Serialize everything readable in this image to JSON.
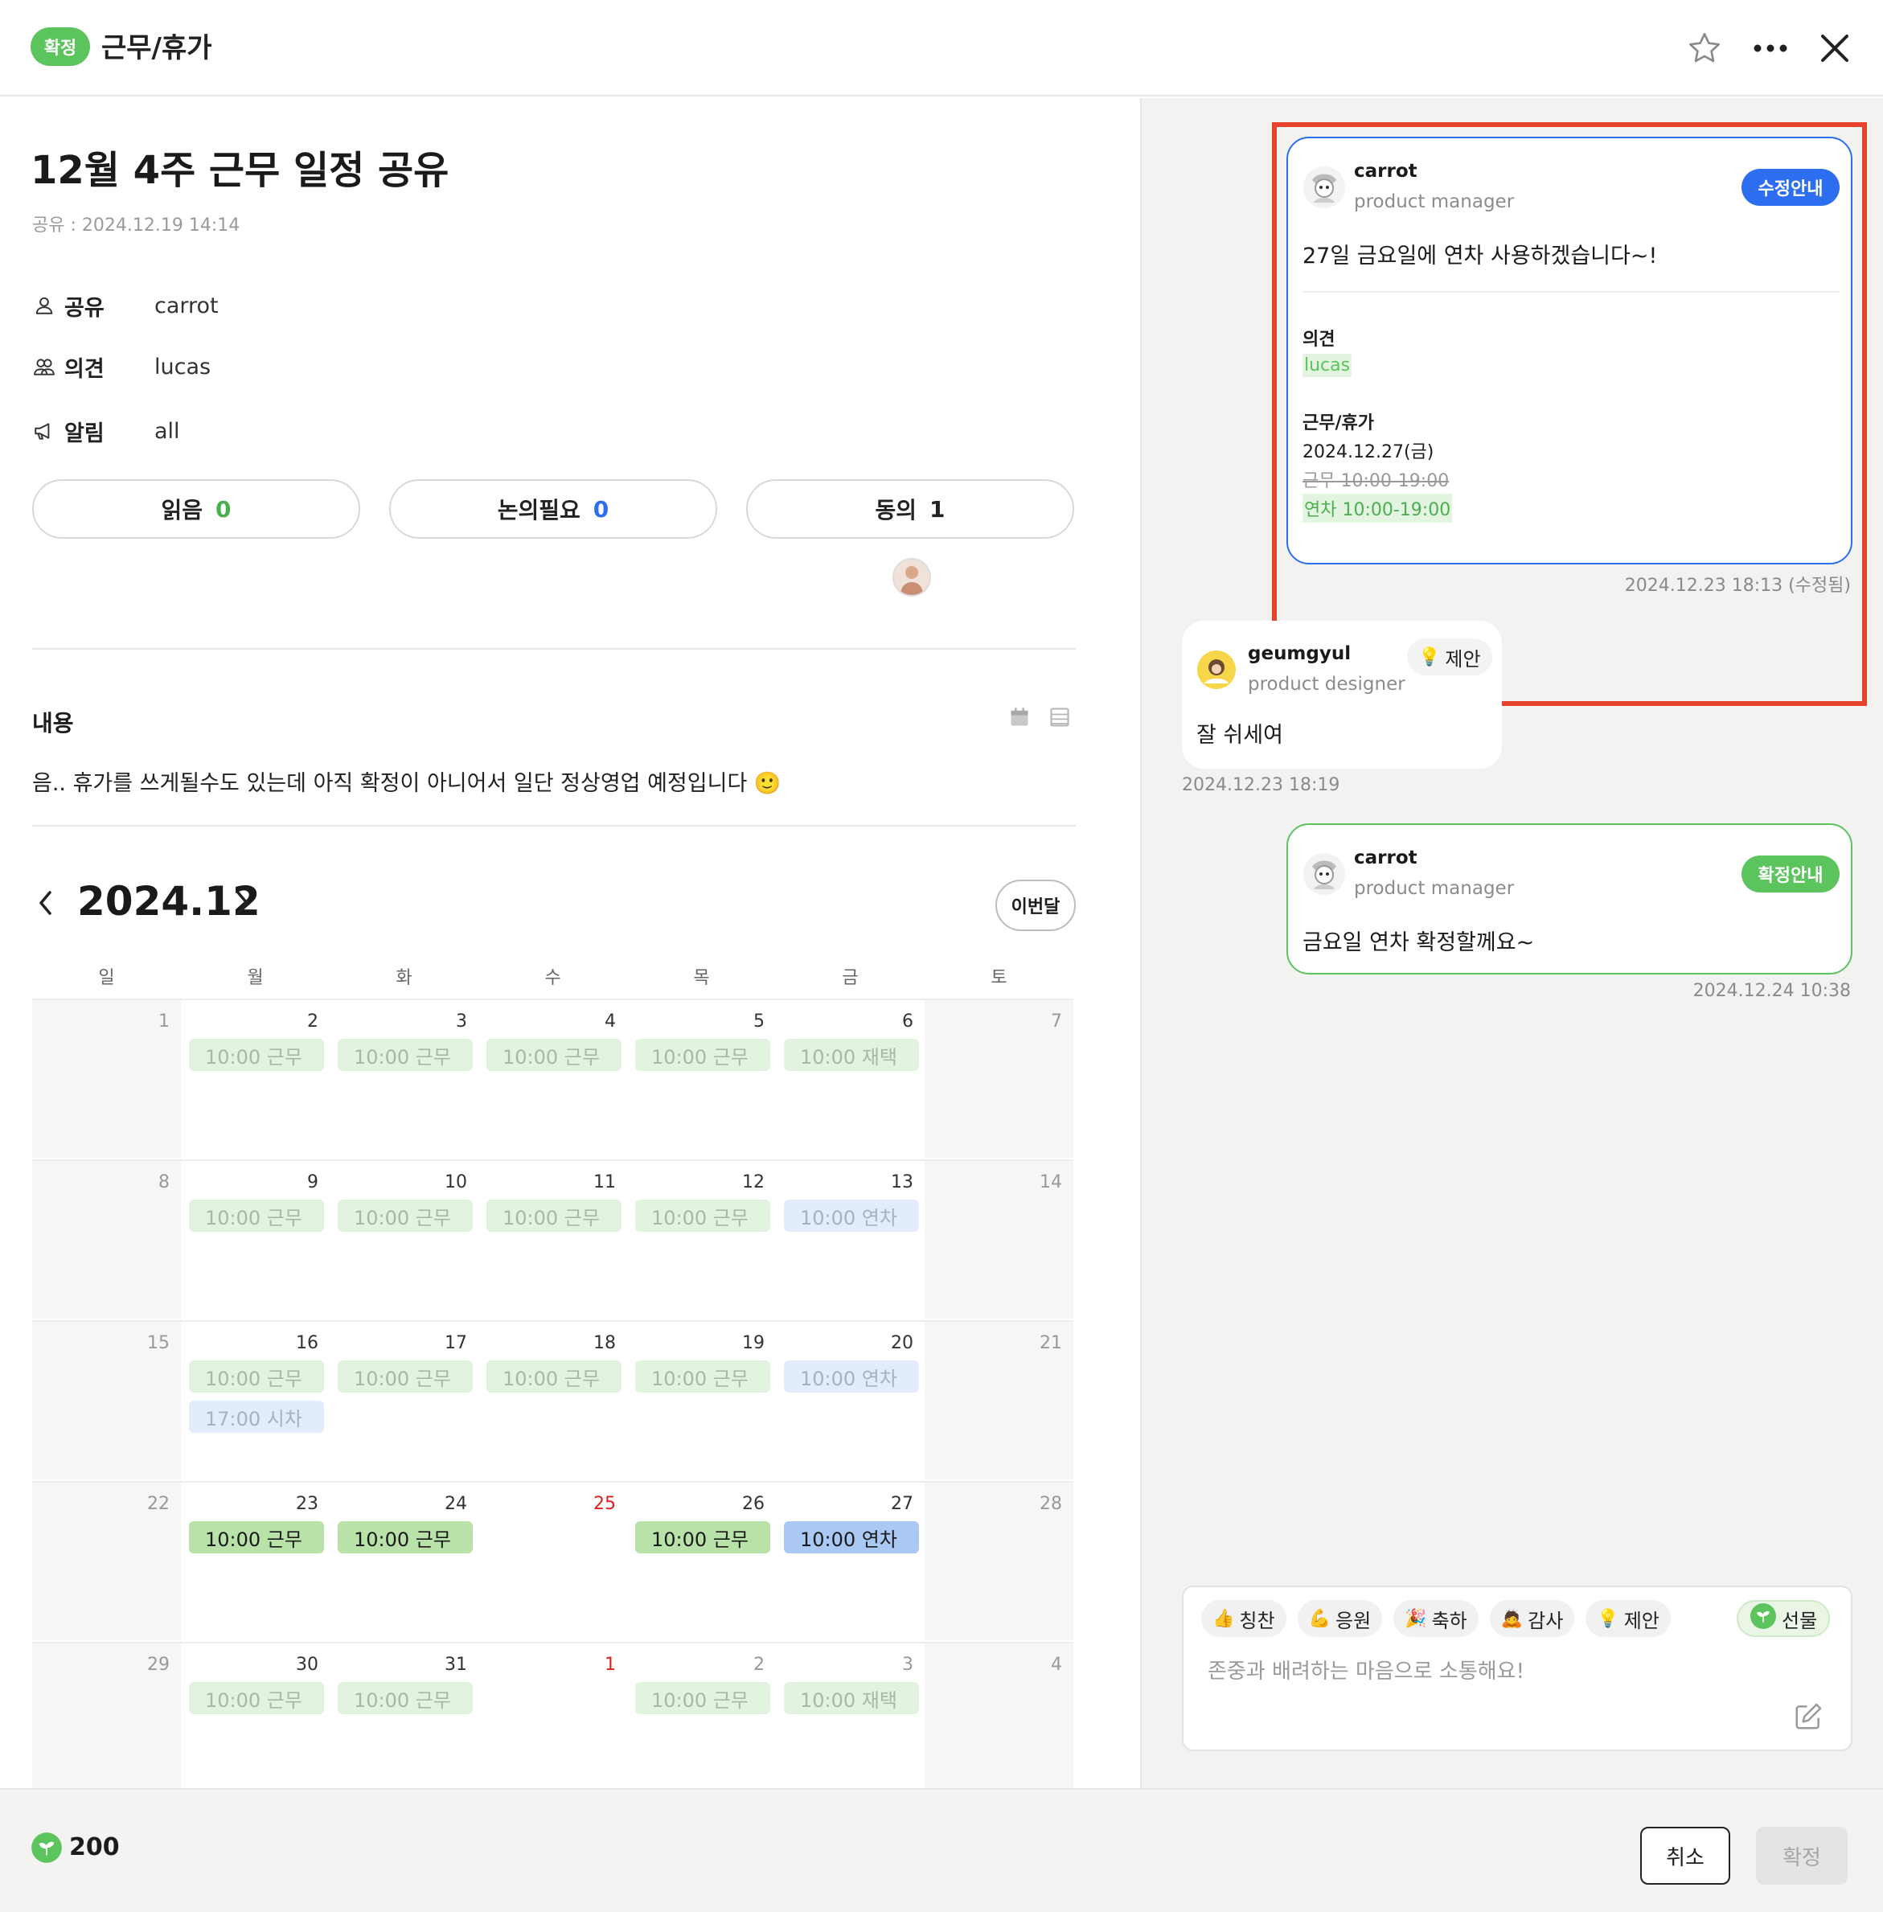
{
  "header": {
    "status_badge": "확정",
    "title": "근무/휴가"
  },
  "document": {
    "title": "12월 4주 근무 일정 공유",
    "shared_date": "공유 : 2024.12.19 14:14",
    "meta": {
      "share_label": "공유",
      "share_value": "carrot",
      "opinion_label": "의견",
      "opinion_value": "lucas",
      "notify_label": "알림",
      "notify_value": "all"
    },
    "pills": {
      "read_label": "읽음",
      "read_count": "0",
      "discuss_label": "논의필요",
      "discuss_count": "0",
      "agree_label": "동의",
      "agree_count": "1"
    },
    "content_label": "내용",
    "content_text": "음.. 휴가를 쓰게될수도 있는데 아직 확정이 아니어서 일단 정상영업 예정입니다 🙂"
  },
  "calendar": {
    "title": "2024.12",
    "this_month_label": "이번달",
    "weekdays": [
      "일",
      "월",
      "화",
      "수",
      "목",
      "금",
      "토"
    ],
    "weeks": [
      [
        {
          "d": "1"
        },
        {
          "d": "2",
          "ev": [
            {
              "t": "10:00 근무",
              "s": "work-faded"
            }
          ]
        },
        {
          "d": "3",
          "ev": [
            {
              "t": "10:00 근무",
              "s": "work-faded"
            }
          ]
        },
        {
          "d": "4",
          "ev": [
            {
              "t": "10:00 근무",
              "s": "work-faded"
            }
          ]
        },
        {
          "d": "5",
          "ev": [
            {
              "t": "10:00 근무",
              "s": "work-faded"
            }
          ]
        },
        {
          "d": "6",
          "ev": [
            {
              "t": "10:00 재택",
              "s": "work-faded"
            }
          ]
        },
        {
          "d": "7"
        }
      ],
      [
        {
          "d": "8"
        },
        {
          "d": "9",
          "ev": [
            {
              "t": "10:00 근무",
              "s": "work-faded"
            }
          ]
        },
        {
          "d": "10",
          "ev": [
            {
              "t": "10:00 근무",
              "s": "work-faded"
            }
          ]
        },
        {
          "d": "11",
          "ev": [
            {
              "t": "10:00 근무",
              "s": "work-faded"
            }
          ]
        },
        {
          "d": "12",
          "ev": [
            {
              "t": "10:00 근무",
              "s": "work-faded"
            }
          ]
        },
        {
          "d": "13",
          "ev": [
            {
              "t": "10:00 연차",
              "s": "leave-faded"
            }
          ]
        },
        {
          "d": "14"
        }
      ],
      [
        {
          "d": "15"
        },
        {
          "d": "16",
          "ev": [
            {
              "t": "10:00 근무",
              "s": "work-faded"
            },
            {
              "t": "17:00 시차",
              "s": "leave-faded"
            }
          ]
        },
        {
          "d": "17",
          "ev": [
            {
              "t": "10:00 근무",
              "s": "work-faded"
            }
          ]
        },
        {
          "d": "18",
          "ev": [
            {
              "t": "10:00 근무",
              "s": "work-faded"
            }
          ]
        },
        {
          "d": "19",
          "ev": [
            {
              "t": "10:00 근무",
              "s": "work-faded"
            }
          ]
        },
        {
          "d": "20",
          "ev": [
            {
              "t": "10:00 연차",
              "s": "leave-faded"
            }
          ]
        },
        {
          "d": "21"
        }
      ],
      [
        {
          "d": "22"
        },
        {
          "d": "23",
          "ev": [
            {
              "t": "10:00 근무",
              "s": "work"
            }
          ]
        },
        {
          "d": "24",
          "ev": [
            {
              "t": "10:00 근무",
              "s": "work"
            }
          ]
        },
        {
          "d": "25",
          "red": true
        },
        {
          "d": "26",
          "ev": [
            {
              "t": "10:00 근무",
              "s": "work"
            }
          ]
        },
        {
          "d": "27",
          "ev": [
            {
              "t": "10:00 연차",
              "s": "leave"
            }
          ]
        },
        {
          "d": "28"
        }
      ],
      [
        {
          "d": "29"
        },
        {
          "d": "30",
          "ev": [
            {
              "t": "10:00 근무",
              "s": "work-faded"
            }
          ]
        },
        {
          "d": "31",
          "ev": [
            {
              "t": "10:00 근무",
              "s": "work-faded"
            }
          ]
        },
        {
          "d": "1",
          "red": true
        },
        {
          "d": "2",
          "muted": true,
          "ev": [
            {
              "t": "10:00 근무",
              "s": "work-faded"
            }
          ]
        },
        {
          "d": "3",
          "muted": true,
          "ev": [
            {
              "t": "10:00 재택",
              "s": "work-faded"
            }
          ]
        },
        {
          "d": "4",
          "muted": true
        }
      ]
    ]
  },
  "comments": {
    "c1": {
      "name": "carrot",
      "role": "product manager",
      "tag": "수정안내",
      "message": "27일 금요일에 연차 사용하겠습니다~!",
      "opinion_label": "의견",
      "opinion_user": "lucas",
      "work_label": "근무/휴가",
      "work_date": "2024.12.27(금)",
      "old_value": "근무 10:00-19:00",
      "new_value": "연차 10:00-19:00",
      "timestamp": "2024.12.23 18:13 (수정됨)",
      "accent": "#2d6ef0",
      "highlight": "#e8412c"
    },
    "c2": {
      "name": "geumgyul",
      "role": "product designer",
      "tag": "제안",
      "message": "잘 쉬세여",
      "timestamp": "2024.12.23 18:19"
    },
    "c3": {
      "name": "carrot",
      "role": "product manager",
      "tag": "확정안내",
      "message": "금요일 연차 확정할께요~",
      "timestamp": "2024.12.24 10:38",
      "accent": "#5cc45d"
    }
  },
  "composer": {
    "chips": [
      {
        "icon": "👍",
        "label": "칭찬"
      },
      {
        "icon": "💪",
        "label": "응원"
      },
      {
        "icon": "🎉",
        "label": "축하"
      },
      {
        "icon": "🙇",
        "label": "감사"
      },
      {
        "icon": "💡",
        "label": "제안"
      }
    ],
    "gift_label": "선물",
    "placeholder": "존중과 배려하는 마음으로 소통해요!"
  },
  "footer": {
    "points": "200",
    "cancel_label": "취소",
    "confirm_label": "확정"
  },
  "colors": {
    "green": "#5cc45d",
    "blue": "#2d6ef0",
    "red": "#e8412c"
  }
}
